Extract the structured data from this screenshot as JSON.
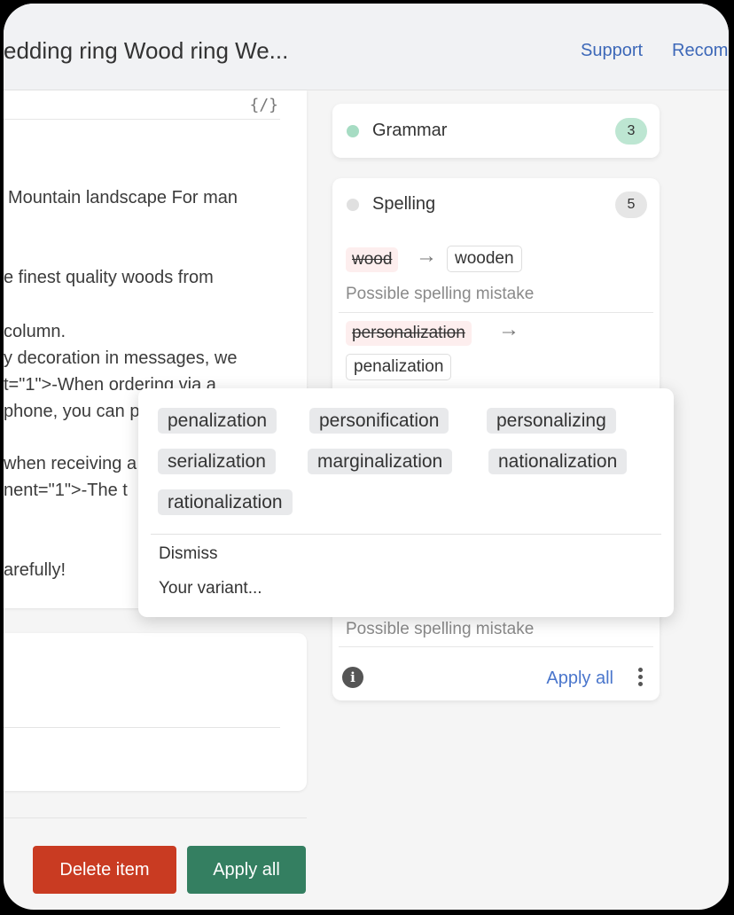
{
  "header": {
    "title": "edding ring Wood ring We...",
    "nav_links": [
      "Support",
      "Recom"
    ]
  },
  "editor": {
    "code_icon": "{/}",
    "lines": [
      "Mountain landscape For man",
      "e finest quality woods from",
      "column.",
      "y decoration in messages, ",
      "t=\"1\">-When ordering via a",
      "phone, you can p",
      "when receiving a",
      "nent=\"1\">-The t",
      "arefully!"
    ],
    "flagged_word": "we"
  },
  "actions": {
    "delete_label": "Delete item",
    "apply_label": "Apply all"
  },
  "colors": {
    "delete": "#c93b22",
    "apply": "#347f61",
    "link": "#3d68b8",
    "grammar_dot": "#a6dcc3",
    "spelling_dot": "#e0e0e0",
    "error_underline": "#e8787a"
  },
  "grammar": {
    "label": "Grammar",
    "count": "3"
  },
  "spelling": {
    "label": "Spelling",
    "count": "5",
    "items": [
      {
        "wrong": "wood",
        "suggestion": "wooden",
        "hint": "Possible spelling mistake"
      },
      {
        "wrong": "personalization",
        "suggestion": "penalization",
        "hint": "Possible spelling mistake"
      }
    ],
    "arrow": "→",
    "apply_all": "Apply all",
    "info_icon": "i"
  },
  "popup": {
    "suggestions": [
      "penalization",
      "personification",
      "personalizing",
      "serialization",
      "marginalization",
      "nationalization",
      "rationalization"
    ],
    "dismiss": "Dismiss",
    "your_variant": "Your variant..."
  }
}
